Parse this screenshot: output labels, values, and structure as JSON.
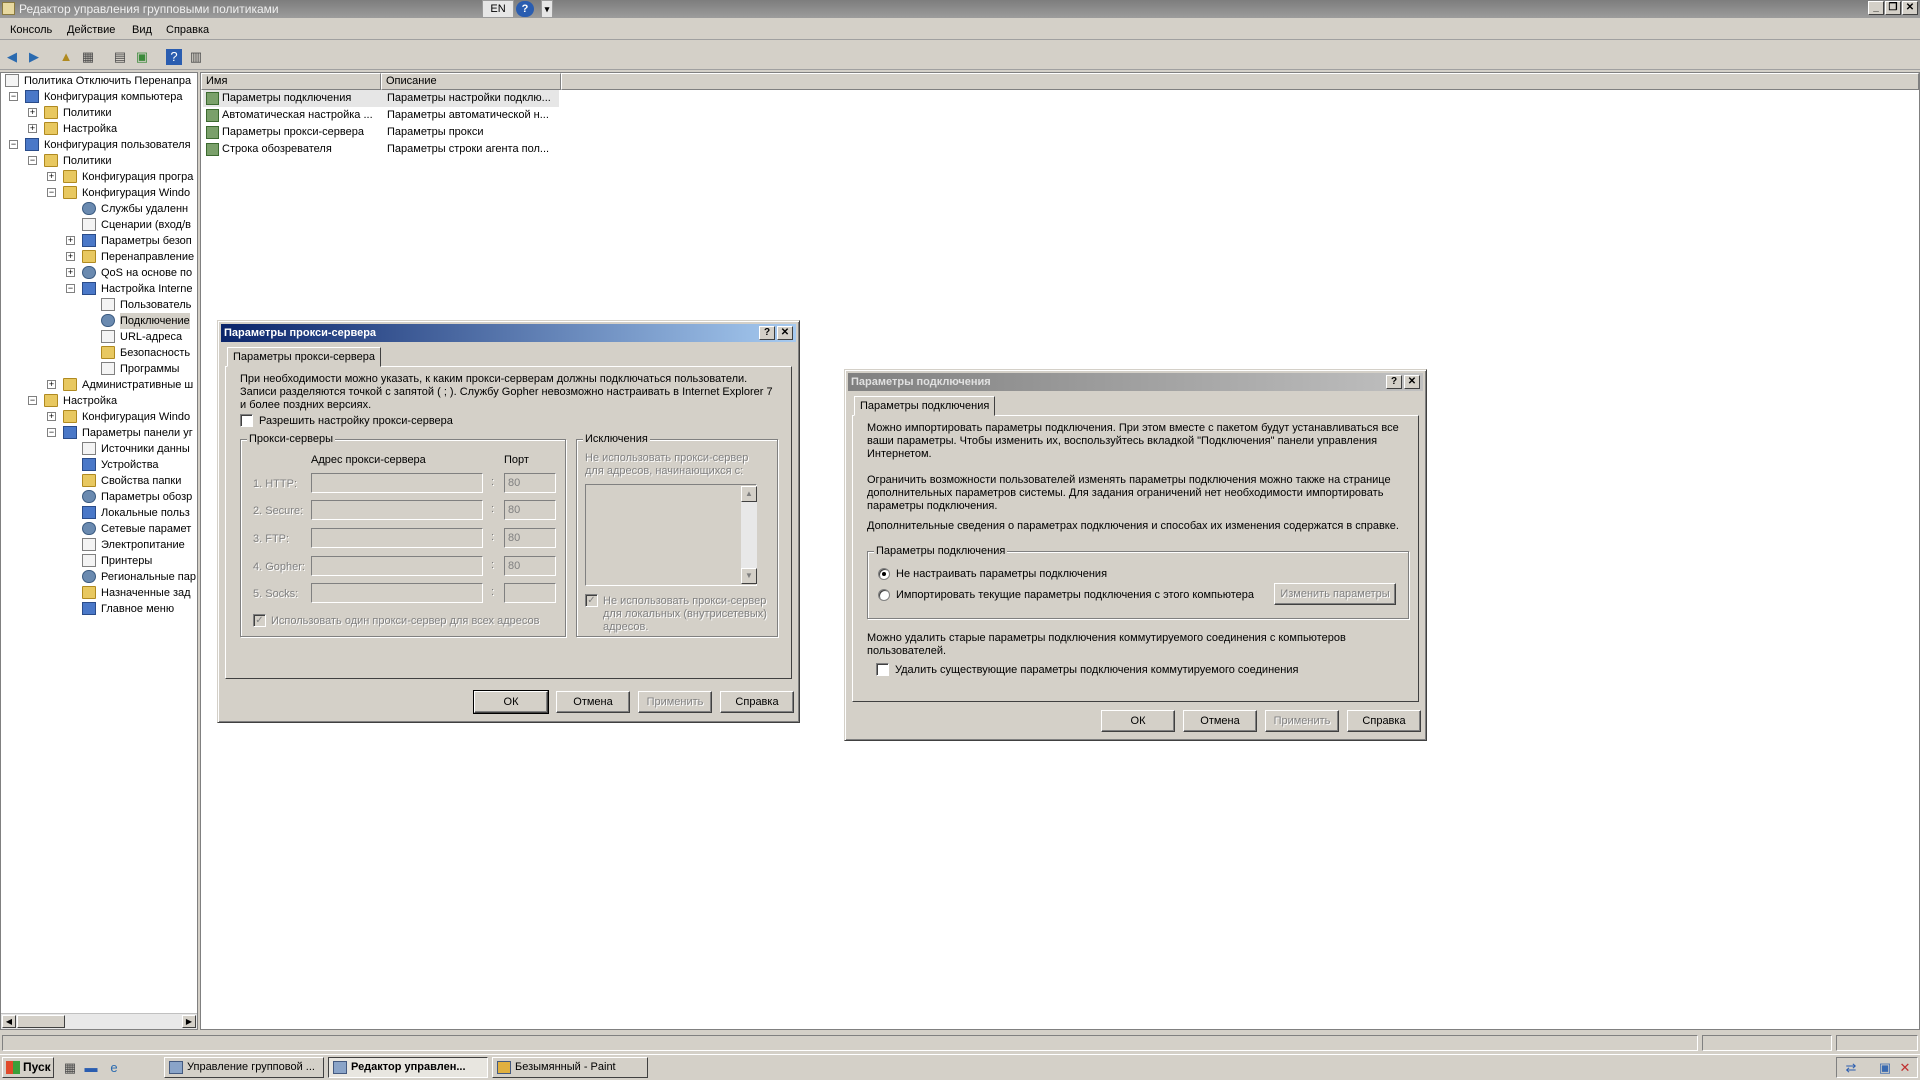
{
  "window": {
    "title": "Редактор управления групповыми политиками",
    "lang": "EN",
    "help_icon": "?",
    "minimize": "_",
    "restore": "❐",
    "close": "✕"
  },
  "menu": [
    "Консоль",
    "Действие",
    "Вид",
    "Справка"
  ],
  "toolbar_icons": [
    "back-arrow-icon",
    "forward-arrow-icon",
    "up-folder-icon",
    "show-tree-icon",
    "export-list-icon",
    "properties-icon",
    "help-icon",
    "view-icon"
  ],
  "tree": [
    {
      "label": "Политика Отключить Перенапра",
      "exp": ""
    },
    {
      "label": "Конфигурация компьютера",
      "exp": "−"
    },
    {
      "label": "Политики",
      "exp": "+"
    },
    {
      "label": "Настройка",
      "exp": "+"
    },
    {
      "label": "Конфигурация пользователя",
      "exp": "−"
    },
    {
      "label": "Политики",
      "exp": "−"
    },
    {
      "label": "Конфигурация програ",
      "exp": "+"
    },
    {
      "label": "Конфигурация Windo",
      "exp": "−"
    },
    {
      "label": "Службы удаленн",
      "exp": ""
    },
    {
      "label": "Сценарии (вход/в",
      "exp": ""
    },
    {
      "label": "Параметры безоп",
      "exp": "+"
    },
    {
      "label": "Перенаправление",
      "exp": "+"
    },
    {
      "label": "QoS на основе по",
      "exp": "+"
    },
    {
      "label": "Настройка Interne",
      "exp": "−"
    },
    {
      "label": "Пользователь",
      "exp": ""
    },
    {
      "label": "Подключение",
      "exp": ""
    },
    {
      "label": "URL-адреса",
      "exp": ""
    },
    {
      "label": "Безопасность",
      "exp": ""
    },
    {
      "label": "Программы",
      "exp": ""
    },
    {
      "label": "Административные ш",
      "exp": "+"
    },
    {
      "label": "Настройка",
      "exp": "−"
    },
    {
      "label": "Конфигурация Windo",
      "exp": "+"
    },
    {
      "label": "Параметры панели уг",
      "exp": "−"
    },
    {
      "label": "Источники данны",
      "exp": ""
    },
    {
      "label": "Устройства",
      "exp": ""
    },
    {
      "label": "Свойства папки",
      "exp": ""
    },
    {
      "label": "Параметры обозр",
      "exp": ""
    },
    {
      "label": "Локальные польз",
      "exp": ""
    },
    {
      "label": "Сетевые парамет",
      "exp": ""
    },
    {
      "label": "Электропитание",
      "exp": ""
    },
    {
      "label": "Принтеры",
      "exp": ""
    },
    {
      "label": "Региональные пар",
      "exp": ""
    },
    {
      "label": "Назначенные зад",
      "exp": ""
    },
    {
      "label": "Главное меню",
      "exp": ""
    }
  ],
  "list": {
    "col_name": "Имя",
    "col_desc": "Описание",
    "rows": [
      {
        "name": "Параметры подключения",
        "desc": "Параметры настройки подклю..."
      },
      {
        "name": "Автоматическая настройка ...",
        "desc": "Параметры автоматической н..."
      },
      {
        "name": "Параметры прокси-сервера",
        "desc": "Параметры прокси"
      },
      {
        "name": "Строка обозревателя",
        "desc": "Параметры строки агента пол..."
      }
    ]
  },
  "proxy_dialog": {
    "title": "Параметры прокси-сервера",
    "help_btn": "?",
    "close_btn": "✕",
    "tab": "Параметры прокси-сервера",
    "intro": "При необходимости можно указать, к каким прокси-серверам должны подключаться пользователи. Записи разделяются точкой с запятой ( ; ). Службу Gopher невозможно настраивать в Internet Explorer 7 и более поздних версиях.",
    "enable_label": "Разрешить настройку прокси-сервера",
    "servers_group": "Прокси-серверы",
    "addr_header": "Адрес прокси-сервера",
    "port_header": "Порт",
    "servers": [
      {
        "label": "1. HTTP:",
        "port": "80"
      },
      {
        "label": "2. Secure:",
        "port": "80"
      },
      {
        "label": "3. FTP:",
        "port": "80"
      },
      {
        "label": "4. Gopher:",
        "port": "80"
      },
      {
        "label": "5. Socks:",
        "port": ""
      }
    ],
    "colon": ":",
    "same_proxy_label": "Использовать один прокси-сервер для всех адресов",
    "exceptions_group": "Исключения",
    "exceptions_hint": "Не использовать прокси-сервер для адресов, начинающихся с:",
    "local_label": "Не использовать прокси-сервер для локальных (внутрисетевых) адресов.",
    "ok": "ОК",
    "cancel": "Отмена",
    "apply": "Применить",
    "help": "Справка"
  },
  "conn_dialog": {
    "title": "Параметры подключения",
    "help_btn": "?",
    "close_btn": "✕",
    "tab": "Параметры подключения",
    "p1": "Можно импортировать параметры подключения. При этом вместе с пакетом будут устанавливаться все ваши параметры. Чтобы изменить их, воспользуйтесь вкладкой \"Подключения\" панели управления Интернетом.",
    "p2": "Ограничить возможности пользователей изменять параметры подключения можно также на странице дополнительных параметров системы. Для задания ограничений нет необходимости импортировать параметры подключения.",
    "p3": "Дополнительные сведения о параметрах подключения и способах их изменения содержатся в справке.",
    "group": "Параметры подключения",
    "opt_none": "Не настраивать параметры подключения",
    "opt_import": "Импортировать текущие параметры подключения с этого компьютера",
    "change_btn": "Изменить параметры",
    "p4": "Можно удалить старые параметры подключения коммутируемого соединения с компьютеров пользователей.",
    "delete_label": "Удалить существующие параметры подключения коммутируемого соединения",
    "ok": "ОК",
    "cancel": "Отмена",
    "apply": "Применить",
    "help": "Справка"
  },
  "taskbar": {
    "start": "Пуск",
    "tasks": [
      {
        "label": "Управление групповой ...",
        "active": false
      },
      {
        "label": "Редактор управлен...",
        "active": true
      },
      {
        "label": "Безымянный - Paint",
        "active": false
      }
    ]
  }
}
